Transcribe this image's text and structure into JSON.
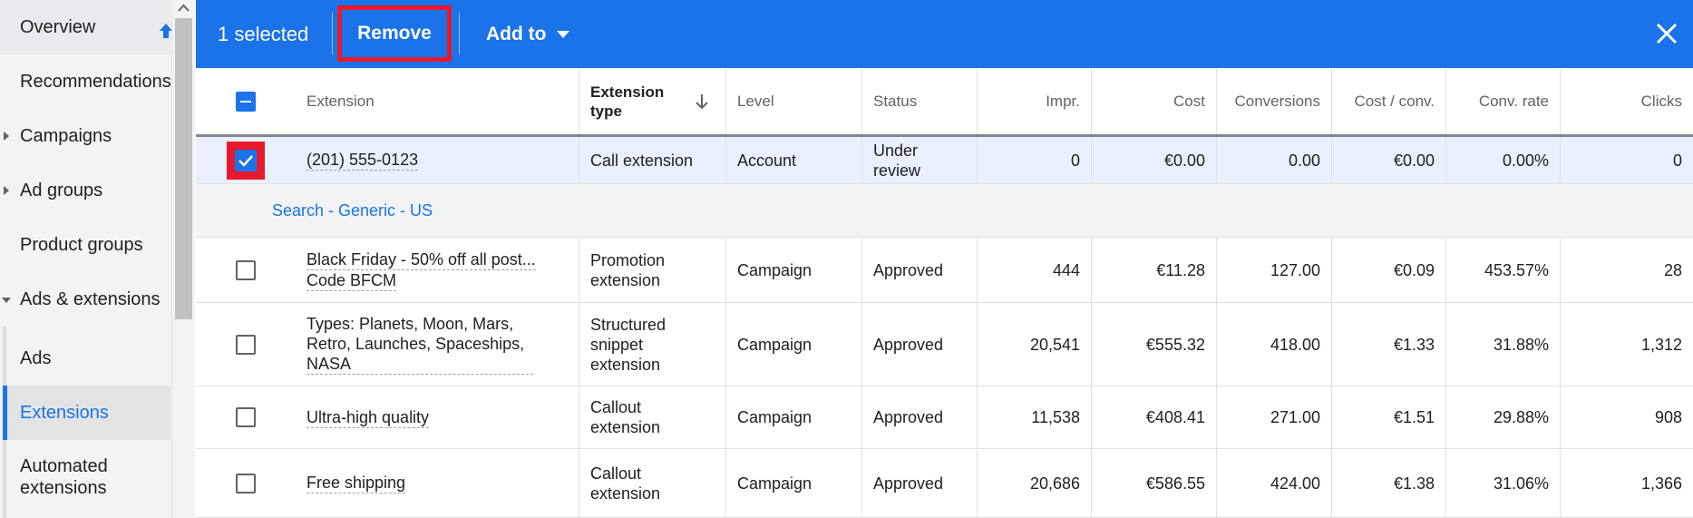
{
  "sidebar": {
    "items": [
      {
        "label": "Overview"
      },
      {
        "label": "Recommendations"
      },
      {
        "label": "Campaigns"
      },
      {
        "label": "Ad groups"
      },
      {
        "label": "Product groups"
      },
      {
        "label": "Ads & extensions"
      },
      {
        "label": "Ads"
      },
      {
        "label": "Extensions"
      },
      {
        "label": "Automated extensions"
      }
    ]
  },
  "action_bar": {
    "selected_text": "1 selected",
    "remove_label": "Remove",
    "add_to_label": "Add to"
  },
  "table": {
    "headers": {
      "extension": "Extension",
      "extension_type": "Extension type",
      "level": "Level",
      "status": "Status",
      "impr": "Impr.",
      "cost": "Cost",
      "conversions": "Conversions",
      "cost_per_conv": "Cost / conv.",
      "conv_rate": "Conv. rate",
      "clicks": "Clicks"
    },
    "selected_row": {
      "extension": "(201) 555-0123",
      "type": "Call extension",
      "level": "Account",
      "status": "Under review",
      "impr": "0",
      "cost": "€0.00",
      "conversions": "0.00",
      "cost_per_conv": "€0.00",
      "conv_rate": "0.00%",
      "clicks": "0"
    },
    "group_label": "Search - Generic - US",
    "rows": [
      {
        "extension": "Black Friday - 50% off all post...",
        "extension_line2": "Code BFCM",
        "type": "Promotion extension",
        "level": "Campaign",
        "status": "Approved",
        "impr": "444",
        "cost": "€11.28",
        "conversions": "127.00",
        "cost_per_conv": "€0.09",
        "conv_rate": "453.57%",
        "clicks": "28"
      },
      {
        "extension": "Types: Planets, Moon, Mars, Retro, Launches, Spaceships, NASA",
        "type": "Structured snippet extension",
        "level": "Campaign",
        "status": "Approved",
        "impr": "20,541",
        "cost": "€555.32",
        "conversions": "418.00",
        "cost_per_conv": "€1.33",
        "conv_rate": "31.88%",
        "clicks": "1,312"
      },
      {
        "extension": "Ultra-high quality",
        "type": "Callout extension",
        "level": "Campaign",
        "status": "Approved",
        "impr": "11,538",
        "cost": "€408.41",
        "conversions": "271.00",
        "cost_per_conv": "€1.51",
        "conv_rate": "29.88%",
        "clicks": "908"
      },
      {
        "extension": "Free shipping",
        "type": "Callout extension",
        "level": "Campaign",
        "status": "Approved",
        "impr": "20,686",
        "cost": "€586.55",
        "conversions": "424.00",
        "cost_per_conv": "€1.38",
        "conv_rate": "31.06%",
        "clicks": "1,366"
      }
    ]
  },
  "colors": {
    "accent": "#1a73e8",
    "highlight_red": "#e8192c",
    "selected_row_bg": "#e8f0fe"
  },
  "icons": [
    "pin-icon",
    "scroll-up-arrow-icon",
    "chevron-down-icon",
    "close-icon",
    "sort-down-arrow-icon",
    "checkmark-icon"
  ]
}
